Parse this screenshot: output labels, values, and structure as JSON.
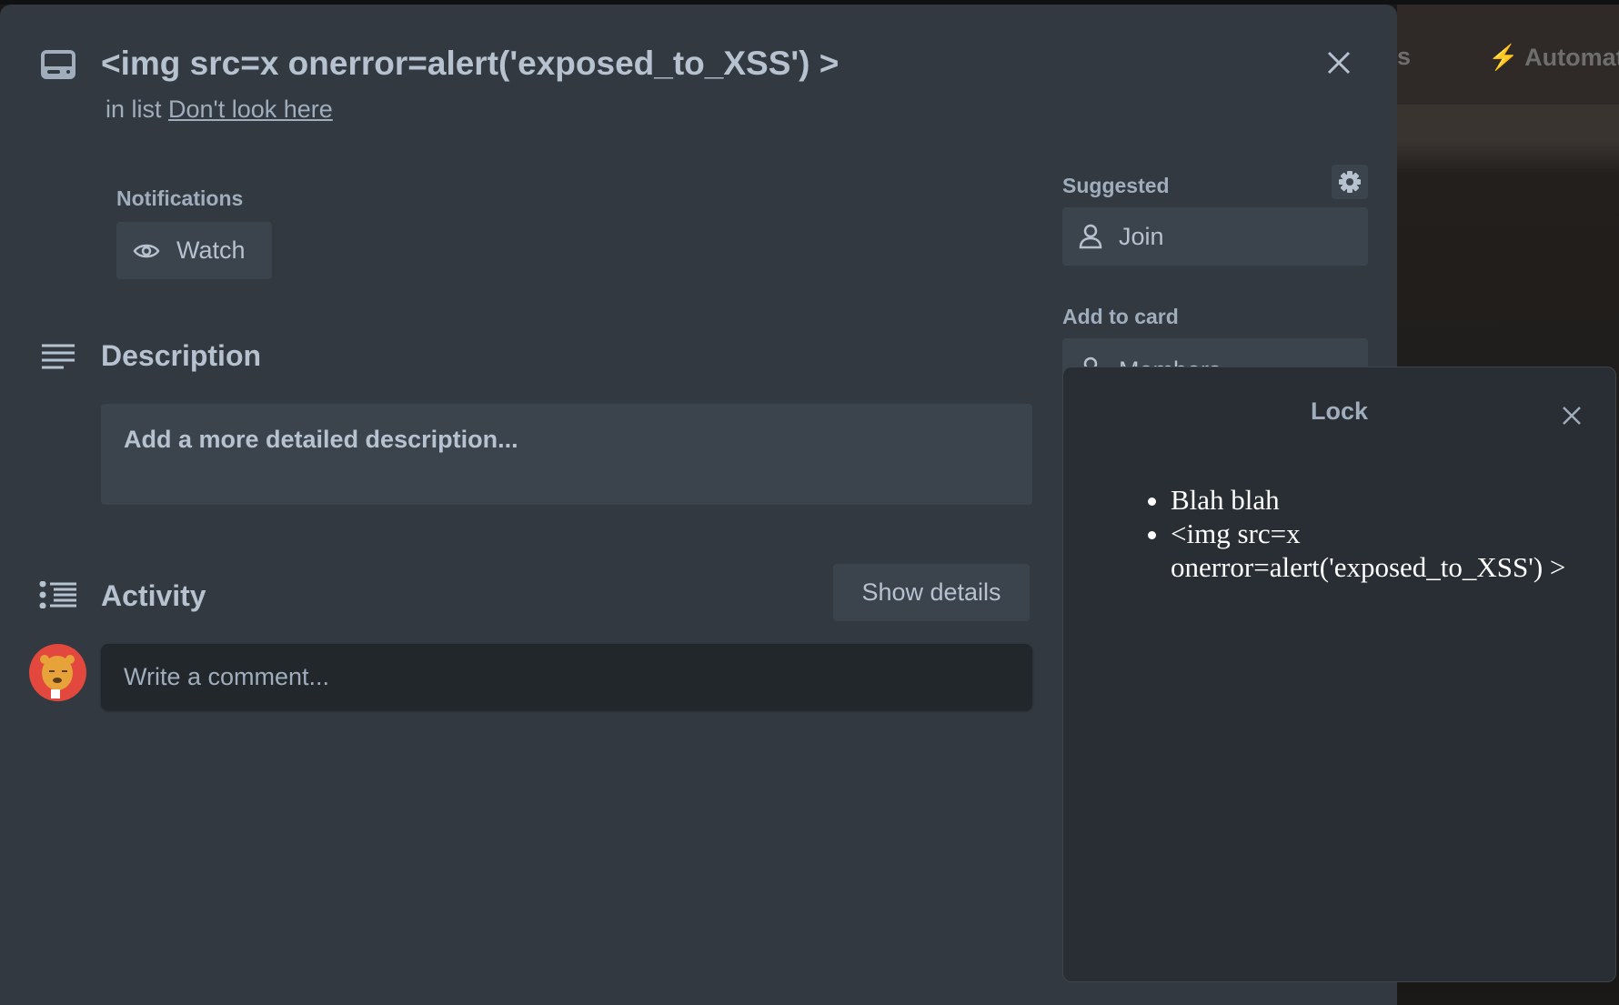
{
  "background": {
    "partial_tab": "s",
    "automation": "Automation"
  },
  "card": {
    "title": "<img src=x onerror=alert('exposed_to_XSS') >",
    "in_list_prefix": "in list",
    "list_name": "Don't look here",
    "notifications_label": "Notifications",
    "watch_label": "Watch",
    "description_heading": "Description",
    "description_placeholder": "Add a more detailed description...",
    "activity_heading": "Activity",
    "show_details_label": "Show details",
    "comment_placeholder": "Write a comment..."
  },
  "sidebar": {
    "suggested_label": "Suggested",
    "join_label": "Join",
    "add_to_card_label": "Add to card",
    "members_label": "Members"
  },
  "popover": {
    "title": "Lock",
    "items": [
      "Blah blah",
      "<img src=x onerror=alert('exposed_to_XSS') >"
    ]
  },
  "colors": {
    "modal_bg": "#323940",
    "popover_bg": "#282e33",
    "text": "#b6c2cf",
    "avatar": "#e2483d"
  }
}
